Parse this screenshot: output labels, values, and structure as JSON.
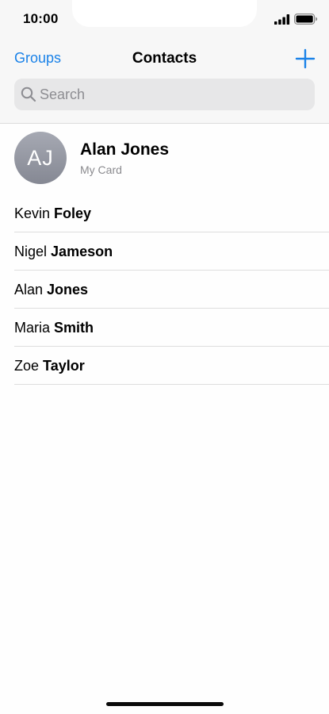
{
  "status_bar": {
    "time": "10:00",
    "signal_icon": "cellular-signal-icon",
    "battery_icon": "battery-full-icon"
  },
  "nav": {
    "left_label": "Groups",
    "title": "Contacts",
    "add_icon": "plus-icon"
  },
  "search": {
    "placeholder": "Search",
    "value": "",
    "icon": "magnifier-icon"
  },
  "my_card": {
    "initials": "AJ",
    "name": "Alan Jones",
    "subtitle": "My Card"
  },
  "contacts": [
    {
      "first": "Kevin",
      "last": "Foley"
    },
    {
      "first": "Nigel",
      "last": "Jameson"
    },
    {
      "first": "Alan",
      "last": "Jones"
    },
    {
      "first": "Maria",
      "last": "Smith"
    },
    {
      "first": "Zoe",
      "last": "Taylor"
    }
  ],
  "colors": {
    "accent": "#1a82e8",
    "header_bg": "#f7f7f7",
    "search_bg": "#e7e7e8",
    "secondary_text": "#8a8a8e"
  }
}
